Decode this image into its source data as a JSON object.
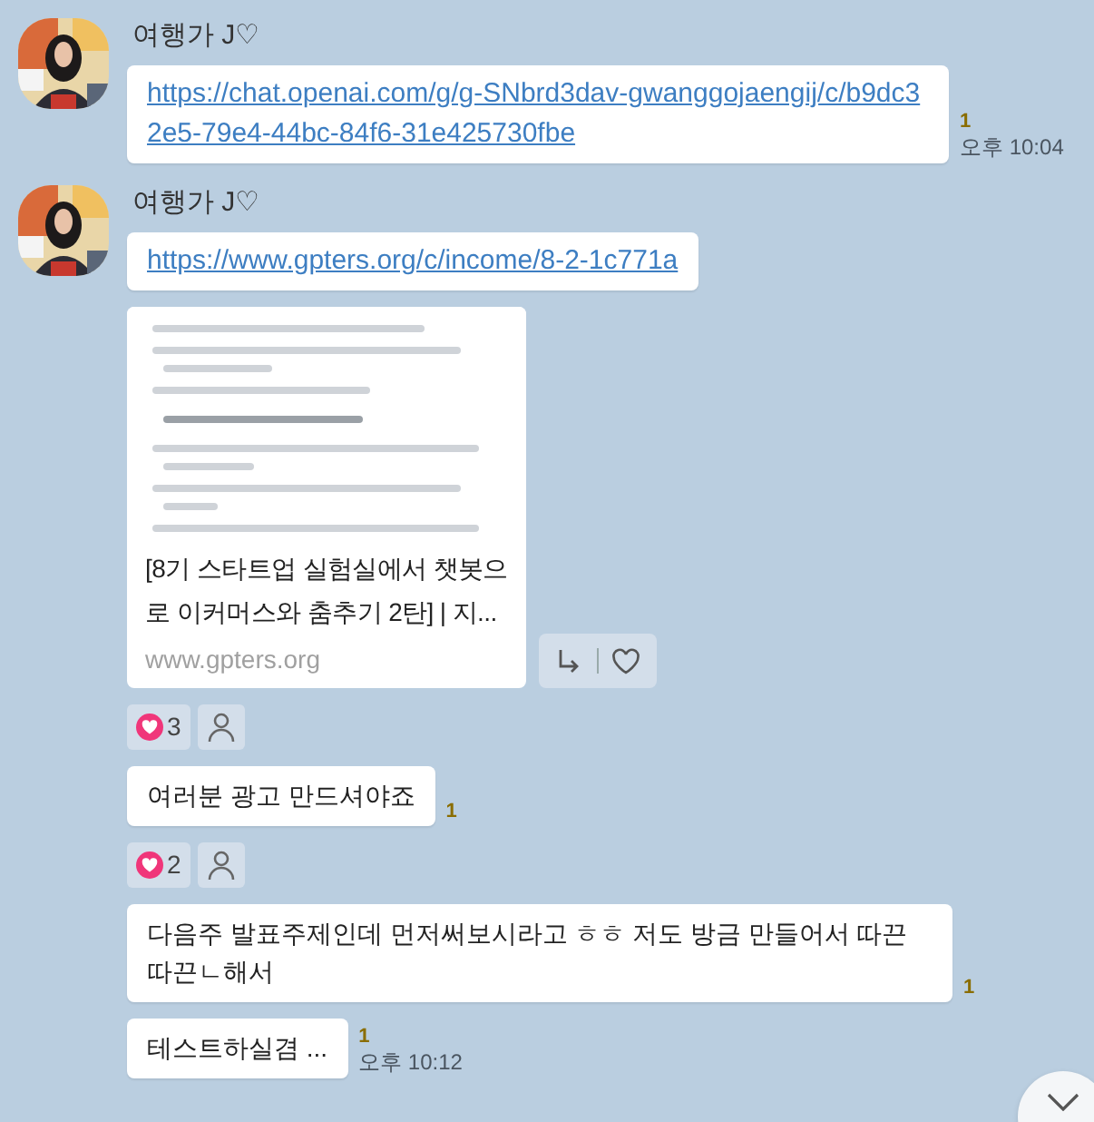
{
  "messages": [
    {
      "sender": "여행가 J♡",
      "items": [
        {
          "kind": "link",
          "text": "https://chat.openai.com/g/g-SNbrd3dav-gwanggojaengij/c/b9dc32e5-79e4-44bc-84f6-31e425730fbe",
          "unread": "1",
          "time": "오후 10:04"
        }
      ]
    },
    {
      "sender": "여행가 J♡",
      "items": [
        {
          "kind": "link",
          "text": "https://www.gpters.org/c/income/8-2-1c771a"
        },
        {
          "kind": "preview",
          "title": "[8기 스타트업 실험실에서 챗봇으로 이커머스와 춤추기 2탄] | 지...",
          "domain": "www.gpters.org"
        },
        {
          "kind": "reactions",
          "count": "3"
        },
        {
          "kind": "text",
          "text": "여러분 광고 만드셔야죠",
          "unread": "1"
        },
        {
          "kind": "reactions",
          "count": "2"
        },
        {
          "kind": "text",
          "text": "다음주 발표주제인데 먼저써보시라고 ㅎㅎ 저도 방금 만들어서 따끈따끈ㄴ해서",
          "unread": "1"
        },
        {
          "kind": "text",
          "text": "테스트하실겸 ...",
          "unread": "1",
          "time": "오후 10:12"
        }
      ]
    }
  ]
}
